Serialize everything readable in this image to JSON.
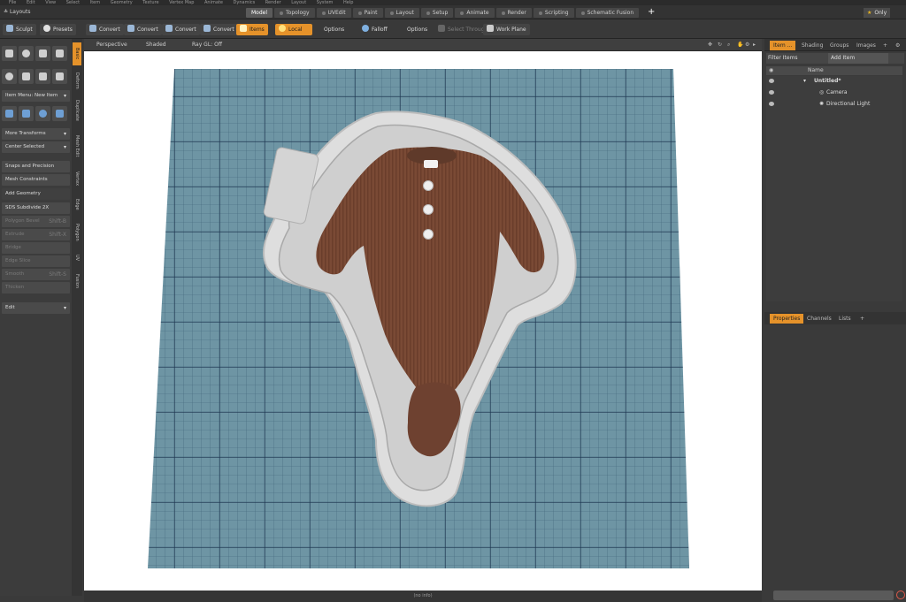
{
  "menu": [
    "File",
    "Edit",
    "View",
    "Select",
    "Item",
    "Geometry",
    "Texture",
    "Vertex Map",
    "Animate",
    "Dynamics",
    "Render",
    "Layout",
    "System",
    "Help"
  ],
  "layout_bar": {
    "layouts_label": "Layouts",
    "tabs": [
      "Model",
      "Topology",
      "UVEdit",
      "Paint",
      "Layout",
      "Setup",
      "Animate",
      "Render",
      "Scripting",
      "Schematic Fusion"
    ],
    "plus": "+",
    "only_label": "Only"
  },
  "toolbar": {
    "sculpt": "Sculpt",
    "presets": "Presets",
    "convert1": "Convert",
    "convert2": "Convert",
    "convert3": "Convert",
    "convert4": "Convert",
    "items": "Items",
    "local": "Local",
    "options1": "Options",
    "falloff": "Falloff",
    "options2": "Options",
    "select_through": "Select Through",
    "work_plane": "Work Plane"
  },
  "left_tabs": [
    "Basic",
    "Deform",
    "Duplicate",
    "Mesh Edit",
    "Vertex",
    "Edge",
    "Polygon",
    "UV",
    "Fusion"
  ],
  "left_panel": {
    "item_menu": "Item Menu: New Item",
    "more_transforms": "More Transforms",
    "center_selected": "Center Selected",
    "snaps": "Snaps and Precision",
    "mesh_constraints": "Mesh Constraints",
    "add_geometry": "Add Geometry",
    "sds_subdivide": "SDS Subdivide 2X",
    "polygon_bevel": "Polygon Bevel",
    "polygon_bevel_key": "Shift-B",
    "extrude": "Extrude",
    "extrude_key": "Shift-X",
    "bridge": "Bridge",
    "edge_slice": "Edge Slice",
    "smooth": "Smooth",
    "smooth_key": "Shift-S",
    "thicken": "Thicken",
    "edit": "Edit"
  },
  "viewport": {
    "perspective": "Perspective",
    "shaded": "Shaded",
    "ray_gl": "Ray GL: Off",
    "status": "(no info)",
    "grid_color": "#6e95a4",
    "grid_major_color": "#1e3550",
    "cutter_color": "#d8d8d8",
    "garment_color": "#7a4a35"
  },
  "right_panel": {
    "tabs": [
      "Item ...",
      "Shading",
      "Groups",
      "Images"
    ],
    "filter": "Filter Items",
    "add_item": "Add Item",
    "name_col": "Name",
    "tree": [
      "Untitled*",
      "Camera",
      "Directional Light"
    ],
    "bottom_tabs": [
      "Properties",
      "Channels",
      "Lists"
    ]
  }
}
